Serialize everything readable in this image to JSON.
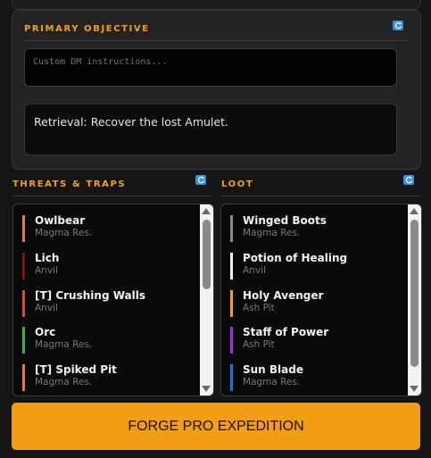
{
  "objective": {
    "title": "PRIMARY OBJECTIVE",
    "custom_placeholder": "Custom DM instructions...",
    "custom_value": "",
    "text": "Retrieval: Recover the lost Amulet.",
    "refresh_icon": "refresh-icon"
  },
  "threats": {
    "title": "THREATS & TRAPS",
    "refresh_icon": "refresh-icon",
    "items": [
      {
        "name": "Owlbear",
        "location": "Magma Res.",
        "color": "#e07f32"
      },
      {
        "name": "Lich",
        "location": "Anvil",
        "color": "#7a1414"
      },
      {
        "name": "[T] Crushing Walls",
        "location": "Anvil",
        "color": "#d24b3c"
      },
      {
        "name": "Orc",
        "location": "Magma Res.",
        "color": "#34b35c"
      },
      {
        "name": "[T] Spiked Pit",
        "location": "Magma Res.",
        "color": "#e07f32"
      }
    ]
  },
  "loot": {
    "title": "LOOT",
    "refresh_icon": "refresh-icon",
    "items": [
      {
        "name": "Winged Boots",
        "location": "Magma Res.",
        "color": "#8a8a8a"
      },
      {
        "name": "Potion of Healing",
        "location": "Anvil",
        "color": "#f2f2f2"
      },
      {
        "name": "Holy Avenger",
        "location": "Ash Pit",
        "color": "#f0a024"
      },
      {
        "name": "Staff of Power",
        "location": "Ash Pit",
        "color": "#9b30e0"
      },
      {
        "name": "Sun Blade",
        "location": "Magma Res.",
        "color": "#1f6fd8"
      }
    ]
  },
  "actions": {
    "forge_label": "FORGE PRO EXPEDITION"
  },
  "colors": {
    "accent": "#f0a024",
    "button": "#f29e15",
    "refresh": "#3b8fe0"
  }
}
